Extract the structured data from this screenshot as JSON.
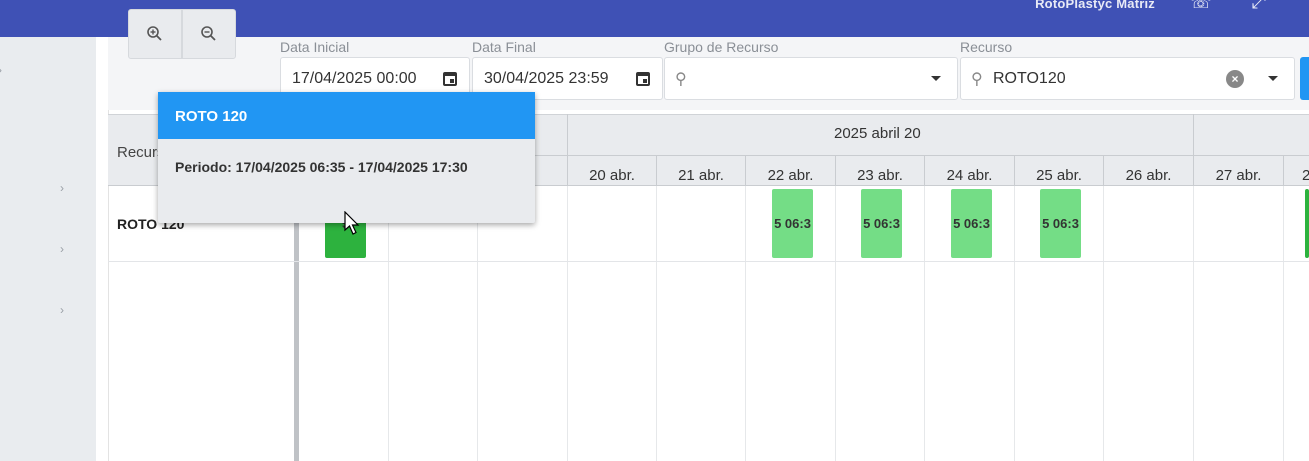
{
  "app": {
    "title": "RotoPlastyc Matriz"
  },
  "topbar": {
    "icons": [
      "support-icon",
      "expand-icon"
    ]
  },
  "toolbar": {
    "zoom_in_icon": "zoom-in-icon",
    "zoom_out_icon": "zoom-out-icon"
  },
  "filters": {
    "start_label": "Data Inicial",
    "start_value": "17/04/2025 00:00",
    "end_label": "Data Final",
    "end_value": "30/04/2025 23:59",
    "group_label": "Grupo de Recurso",
    "group_value": "",
    "resource_label": "Recurso",
    "resource_value": "ROTO120"
  },
  "gantt": {
    "resource_header": "Recurso",
    "week_label": "2025 abril 20",
    "days": [
      "20 abr.",
      "21 abr.",
      "22 abr.",
      "23 abr.",
      "24 abr.",
      "25 abr.",
      "26 abr.",
      "27 abr."
    ],
    "partial_day_left": "r.",
    "partial_day_right": "2",
    "rows": [
      {
        "label": "ROTO 120"
      }
    ],
    "bar_text": "5 06:3",
    "bar_text_dark": "5"
  },
  "tooltip": {
    "title": "ROTO 120",
    "body": "Periodo: 17/04/2025 06:35 - 17/04/2025 17:30"
  },
  "colors": {
    "topbar": "#3f51b5",
    "accent": "#2196f3",
    "bar_light": "#74dd86",
    "bar_dark": "#2db23e"
  }
}
